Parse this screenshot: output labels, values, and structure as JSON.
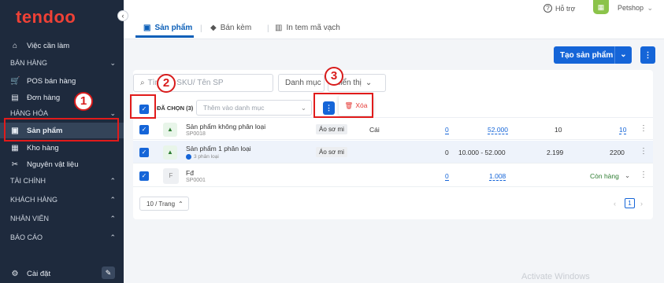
{
  "sidebar": {
    "logo": "tendoo",
    "tasks": "Việc cần làm",
    "groups": {
      "sales": "BÁN HÀNG",
      "goods": "HÀNG HÓA",
      "finance": "TÀI CHÍNH",
      "customers": "KHÁCH HÀNG",
      "staff": "NHÂN VIÊN",
      "reports": "BÁO CÁO"
    },
    "items": {
      "pos": "POS bán hàng",
      "orders": "Đơn hàng",
      "products": "Sản phẩm",
      "warehouse": "Kho hàng",
      "materials": "Nguyên vật liệu"
    },
    "settings": "Cài đặt"
  },
  "header": {
    "help": "Hỗ trợ",
    "shop": "Petshop"
  },
  "tabs": [
    "Sản phẩm",
    "Bán kèm",
    "In tem mã vạch"
  ],
  "toolbar": {
    "create": "Tạo sản phẩm",
    "search_placeholder": "Tìm mã SKU/ Tên SP",
    "category": "Danh mục",
    "display": "Hiển thị"
  },
  "selection": {
    "selected": "ĐÃ CHỌN (3)",
    "add_category": "Thêm vào danh mục",
    "delete": "Xóa"
  },
  "rows": [
    {
      "name": "Sản phẩm không phân loại",
      "sku": "SP0018",
      "category": "Áo sơ mi",
      "unit": "Cái",
      "qty": "0",
      "price": "52.000",
      "stock": "10",
      "total": "10"
    },
    {
      "name": "Sản phẩm 1 phân loại",
      "sku": "3 phân loại",
      "category": "Áo sơ mi",
      "unit": "",
      "qty": "0",
      "price": "10.000 - 52.000",
      "stock": "2.199",
      "total": "2200"
    },
    {
      "name": "Fđ",
      "sku": "SP0001",
      "category": "",
      "unit": "",
      "qty": "0",
      "price": "1.008",
      "stock": "",
      "total": "Còn hàng"
    }
  ],
  "pagination": {
    "per_page": "10 / Trang",
    "page": "1"
  },
  "annotations": {
    "one": "1",
    "two": "2",
    "three": "3"
  },
  "thumb_letter": "F",
  "watermark": "Activate Windows"
}
